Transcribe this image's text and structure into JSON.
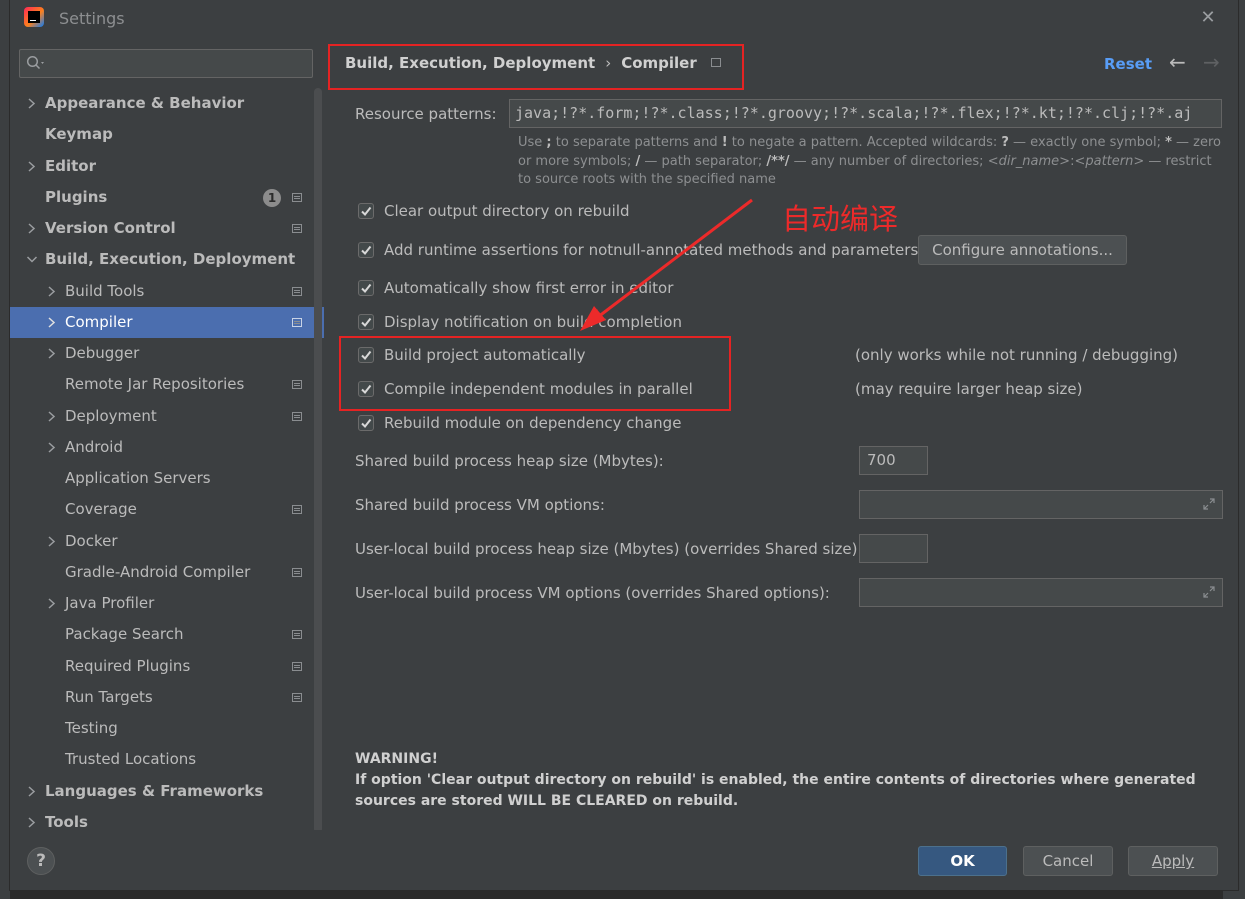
{
  "window": {
    "title": "Settings",
    "close_icon": "close-icon"
  },
  "colors": {
    "selection": "#4b6eaf",
    "accent_link": "#589df6",
    "primary_button": "#365880",
    "annotation_red": "#e52323"
  },
  "sidebar": {
    "search_placeholder": "",
    "items": [
      {
        "label": "Appearance & Behavior"
      },
      {
        "label": "Keymap"
      },
      {
        "label": "Editor"
      },
      {
        "label": "Plugins",
        "badge": "1"
      },
      {
        "label": "Version Control"
      },
      {
        "label": "Build, Execution, Deployment"
      },
      {
        "label": "Build Tools"
      },
      {
        "label": "Compiler"
      },
      {
        "label": "Debugger"
      },
      {
        "label": "Remote Jar Repositories"
      },
      {
        "label": "Deployment"
      },
      {
        "label": "Android"
      },
      {
        "label": "Application Servers"
      },
      {
        "label": "Coverage"
      },
      {
        "label": "Docker"
      },
      {
        "label": "Gradle-Android Compiler"
      },
      {
        "label": "Java Profiler"
      },
      {
        "label": "Package Search"
      },
      {
        "label": "Required Plugins"
      },
      {
        "label": "Run Targets"
      },
      {
        "label": "Testing"
      },
      {
        "label": "Trusted Locations"
      },
      {
        "label": "Languages & Frameworks"
      },
      {
        "label": "Tools"
      }
    ]
  },
  "header": {
    "breadcrumb_parent": "Build, Execution, Deployment",
    "breadcrumb_sep": "›",
    "breadcrumb_current": "Compiler",
    "reset": "Reset",
    "back": "←",
    "forward": "→"
  },
  "compiler": {
    "resource_patterns_label": "Resource patterns:",
    "resource_patterns_value": "java;!?*.form;!?*.class;!?*.groovy;!?*.scala;!?*.flex;!?*.kt;!?*.clj;!?*.aj",
    "hint": {
      "t1": "Use ",
      "b1": ";",
      "t2": " to separate patterns and ",
      "b2": "!",
      "t3": " to negate a pattern. Accepted wildcards: ",
      "b3": "?",
      "t4": " — exactly one symbol; ",
      "b4": "*",
      "t5": " — zero or more symbols; ",
      "b5": "/",
      "t6": " — path separator; ",
      "b6": "/**/",
      "t7": " — any number of directories; ",
      "i1": "<dir_name>",
      "t8": ":",
      "i2": "<pattern>",
      "t9": " — restrict to source roots with the specified name"
    },
    "options": [
      {
        "label": "Clear output directory on rebuild",
        "checked": true
      },
      {
        "label": "Add runtime assertions for notnull-annotated methods and parameters",
        "checked": true
      },
      {
        "label": "Automatically show first error in editor",
        "checked": true
      },
      {
        "label": "Display notification on build completion",
        "checked": true
      },
      {
        "label": "Build project automatically",
        "checked": true
      },
      {
        "label": "Compile independent modules in parallel",
        "checked": true
      },
      {
        "label": "Rebuild module on dependency change",
        "checked": true
      }
    ],
    "configure_annotations": "Configure annotations...",
    "note_build_auto": "(only works while not running / debugging)",
    "note_parallel": "(may require larger heap size)",
    "shared_heap_label": "Shared build process heap size (Mbytes):",
    "shared_heap_value": "700",
    "shared_vm_label": "Shared build process VM options:",
    "shared_vm_value": "",
    "user_heap_label": "User-local build process heap size (Mbytes) (overrides Shared size):",
    "user_heap_value": "",
    "user_vm_label": "User-local build process VM options (overrides Shared options):",
    "user_vm_value": "",
    "warning_title": "WARNING!",
    "warning_text": "If option 'Clear output directory on rebuild' is enabled, the entire contents of directories where generated sources are stored WILL BE CLEARED on rebuild."
  },
  "footer": {
    "help": "?",
    "ok": "OK",
    "cancel": "Cancel",
    "apply": "Apply"
  },
  "annotation": {
    "text": "自动编译"
  }
}
